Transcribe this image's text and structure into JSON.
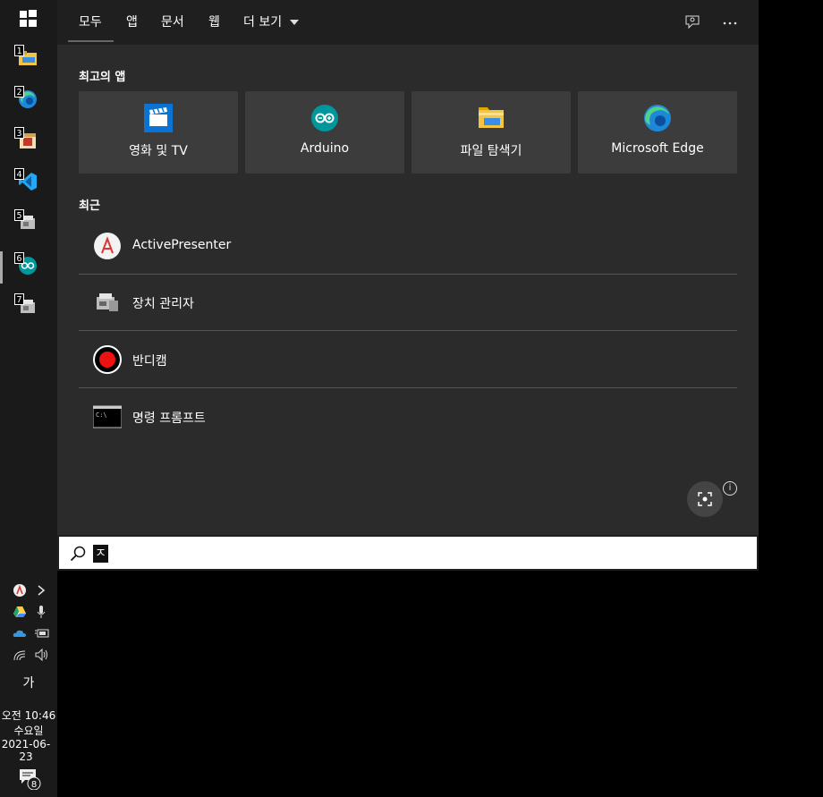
{
  "taskbar": {
    "apps": [
      {
        "num": "1",
        "icon": "file-explorer-icon"
      },
      {
        "num": "2",
        "icon": "edge-icon"
      },
      {
        "num": "3",
        "icon": "app-icon"
      },
      {
        "num": "4",
        "icon": "vscode-icon"
      },
      {
        "num": "5",
        "icon": "device-manager-icon"
      },
      {
        "num": "6",
        "icon": "arduino-icon"
      },
      {
        "num": "7",
        "icon": "device-manager-icon"
      }
    ],
    "ime": "가",
    "time": "오전 10:46",
    "weekday": "수요일",
    "date": "2021-06-23",
    "notification_count": "8"
  },
  "search_panel": {
    "tabs": [
      "모두",
      "앱",
      "문서",
      "웹",
      "더 보기"
    ],
    "top_apps_title": "최고의 앱",
    "top_apps": [
      {
        "label": "영화 및 TV",
        "icon": "movies-tv-icon"
      },
      {
        "label": "Arduino",
        "icon": "arduino-icon"
      },
      {
        "label": "파일 탐색기",
        "icon": "file-explorer-icon"
      },
      {
        "label": "Microsoft Edge",
        "icon": "edge-icon"
      }
    ],
    "recent_title": "최근",
    "recent": [
      {
        "label": "ActivePresenter",
        "icon": "activepresenter-icon"
      },
      {
        "label": "장치 관리자",
        "icon": "device-manager-icon"
      },
      {
        "label": "반디캠",
        "icon": "bandicam-icon"
      },
      {
        "label": "명령 프롬프트",
        "icon": "command-prompt-icon"
      }
    ],
    "info_glyph": "i"
  },
  "search": {
    "value": "ㅈ"
  },
  "colors": {
    "panel_bg": "#2b2b2b",
    "topbar_bg": "#1f1f1f",
    "tile_bg": "#3c3c3c",
    "taskbar_bg": "#1a1a1a"
  }
}
